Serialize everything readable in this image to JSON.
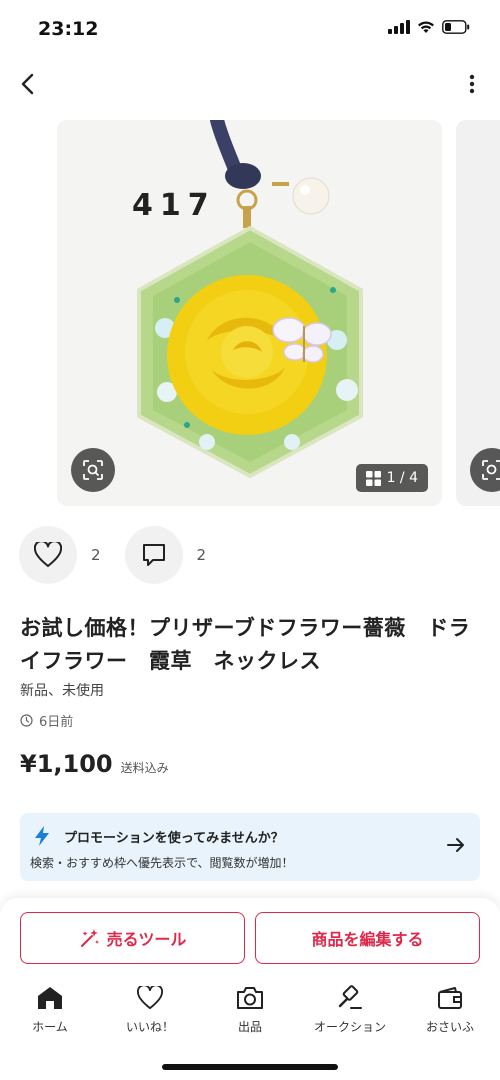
{
  "status_bar": {
    "time": "23:12"
  },
  "product": {
    "photo_counter": "1 / 4",
    "photo_label": "417",
    "likes": "2",
    "comments": "2",
    "title": "お試し価格！プリザーブドフラワー薔薇　ドライフラワー　霞草　ネックレス",
    "condition": "新品、未使用",
    "posted": "6日前",
    "price": "¥1,100",
    "shipping": "送料込み"
  },
  "promo": {
    "title": "プロモーションを使ってみませんか？",
    "subtitle": "検索・おすすめ枠へ優先表示で、閲覧数が増加！",
    "accent": "#1a7fd8"
  },
  "actions": {
    "sell_tool": "売るツール",
    "edit_item": "商品を編集する",
    "accent": "#e0294a"
  },
  "tabbar": {
    "items": [
      {
        "label": "ホーム",
        "icon": "home-icon"
      },
      {
        "label": "いいね！",
        "icon": "heart-icon"
      },
      {
        "label": "出品",
        "icon": "camera-icon"
      },
      {
        "label": "オークション",
        "icon": "gavel-icon"
      },
      {
        "label": "おさいふ",
        "icon": "wallet-icon"
      }
    ]
  }
}
